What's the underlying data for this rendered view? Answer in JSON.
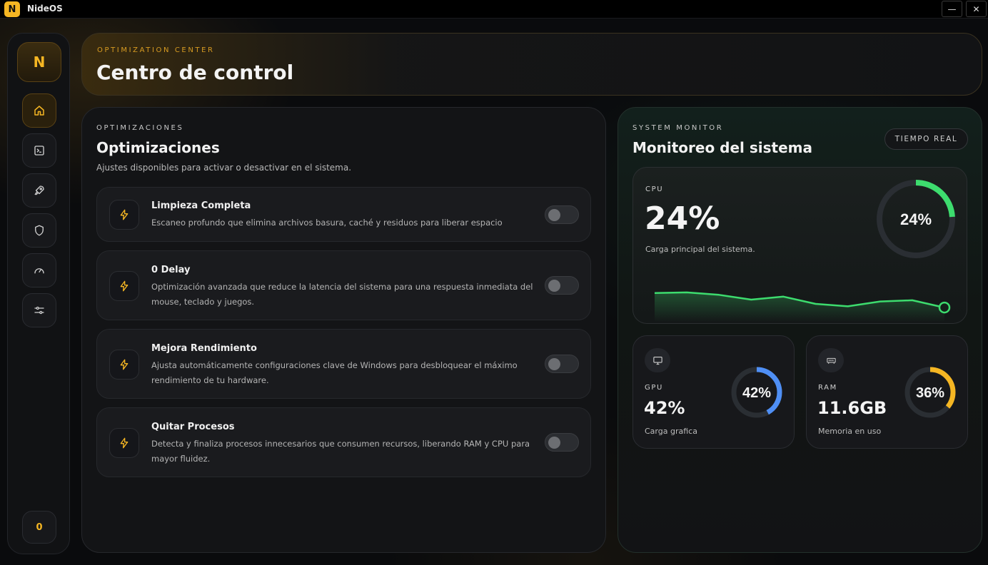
{
  "window": {
    "logo_letter": "N",
    "title": "NideOS",
    "minimize_label": "—",
    "close_label": "✕"
  },
  "sidebar": {
    "logo_letter": "N",
    "items": [
      {
        "icon": "home-icon"
      },
      {
        "icon": "terminal-icon"
      },
      {
        "icon": "rocket-icon"
      },
      {
        "icon": "shield-icon"
      },
      {
        "icon": "speedometer-icon"
      },
      {
        "icon": "sliders-icon"
      }
    ],
    "bottom_label": "0"
  },
  "header": {
    "eyebrow": "OPTIMIZATION CENTER",
    "title": "Centro de control"
  },
  "optimizations": {
    "eyebrow": "OPTIMIZACIONES",
    "title": "Optimizaciones",
    "subtitle": "Ajustes disponibles para activar o desactivar en el sistema.",
    "items": [
      {
        "title": "Limpieza Completa",
        "description": "Escaneo profundo que elimina archivos basura, caché y residuos para liberar espacio",
        "enabled": false
      },
      {
        "title": "0 Delay",
        "description": "Optimización avanzada que reduce la latencia del sistema para una respuesta inmediata del mouse, teclado y juegos.",
        "enabled": false
      },
      {
        "title": "Mejora Rendimiento",
        "description": "Ajusta automáticamente configuraciones clave de Windows para desbloquear el máximo rendimiento de tu hardware.",
        "enabled": false
      },
      {
        "title": "Quitar Procesos",
        "description": "Detecta y finaliza procesos innecesarios que consumen recursos, liberando RAM y CPU para mayor fluidez.",
        "enabled": false
      }
    ]
  },
  "monitor": {
    "eyebrow": "SYSTEM MONITOR",
    "title": "Monitoreo del sistema",
    "badge": "TIEMPO REAL",
    "cpu": {
      "label": "CPU",
      "value": "24%",
      "ring_label": "24%",
      "percent": 24,
      "subtitle": "Carga principal del sistema.",
      "color": "#3ddc6e",
      "history": [
        38,
        39,
        35,
        27,
        32,
        20,
        16,
        24,
        26,
        14
      ]
    },
    "gpu": {
      "icon": "monitor-icon",
      "label": "GPU",
      "value": "42%",
      "ring_label": "42%",
      "percent": 42,
      "subtitle": "Carga grafica",
      "color": "#4f8ff5"
    },
    "ram": {
      "icon": "memory-icon",
      "label": "RAM",
      "value": "11.6GB",
      "ring_label": "36%",
      "percent": 36,
      "subtitle": "Memoria en uso",
      "color": "#f5b623"
    }
  },
  "colors": {
    "accent": "#f5b623",
    "cpu": "#3ddc6e",
    "gpu": "#4f8ff5",
    "ram": "#f5b623"
  }
}
